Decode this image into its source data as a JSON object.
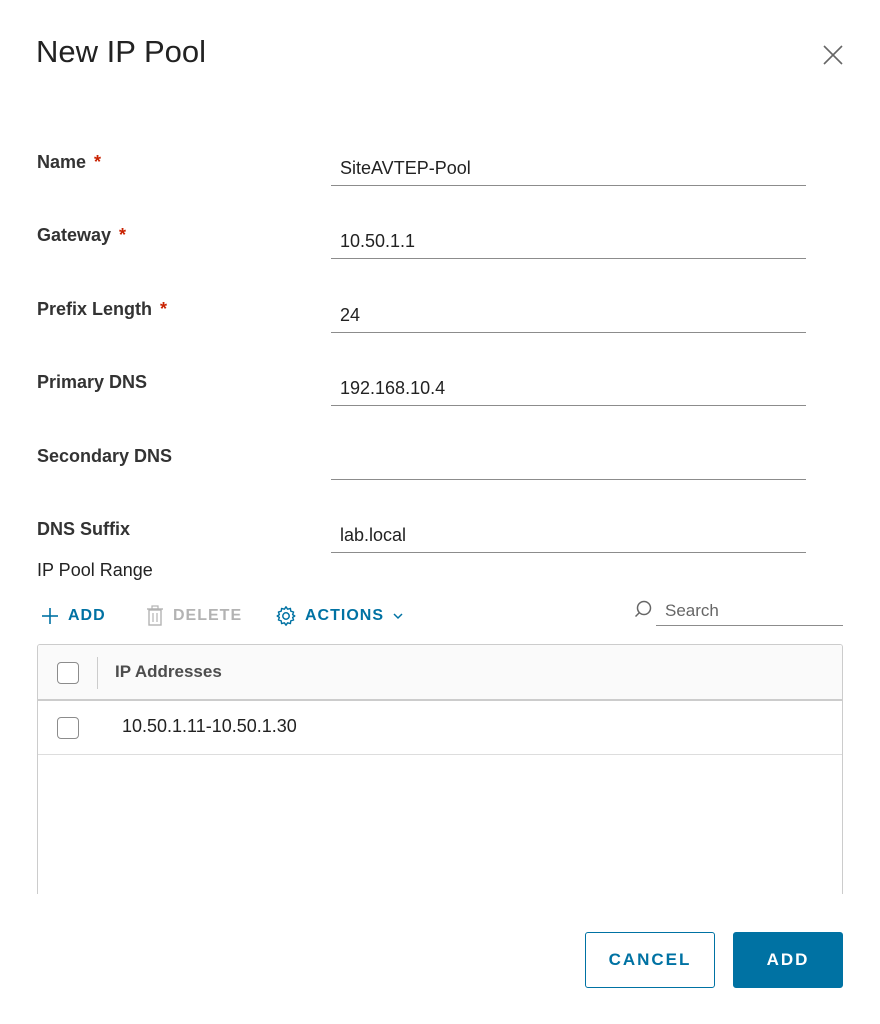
{
  "dialog": {
    "title": "New IP Pool"
  },
  "form": {
    "required_marker": "*",
    "fields": [
      {
        "label": "Name",
        "required": true,
        "value": "SiteAVTEP-Pool"
      },
      {
        "label": "Gateway",
        "required": true,
        "value": "10.50.1.1"
      },
      {
        "label": "Prefix Length",
        "required": true,
        "value": "24"
      },
      {
        "label": "Primary DNS",
        "required": false,
        "value": "192.168.10.4"
      },
      {
        "label": "Secondary DNS",
        "required": false,
        "value": ""
      },
      {
        "label": "DNS Suffix",
        "required": false,
        "value": "lab.local"
      }
    ]
  },
  "range_section": {
    "title": "IP Pool Range",
    "toolbar": {
      "add_label": "ADD",
      "delete_label": "DELETE",
      "actions_label": "ACTIONS"
    },
    "search": {
      "placeholder": "Search",
      "value": ""
    },
    "grid": {
      "columns": [
        "IP Addresses"
      ],
      "rows": [
        {
          "ip_addresses": "10.50.1.11-10.50.1.30"
        }
      ]
    }
  },
  "footer": {
    "cancel_label": "CANCEL",
    "submit_label": "ADD"
  },
  "colors": {
    "accent": "#0072a3",
    "required": "#c92100",
    "disabled": "#b3b3b3"
  },
  "icons": {
    "close": "close-icon",
    "add": "plus-icon",
    "delete": "trash-icon",
    "actions": "gear-icon",
    "actions_dropdown": "chevron-down-icon",
    "search": "search-icon"
  }
}
